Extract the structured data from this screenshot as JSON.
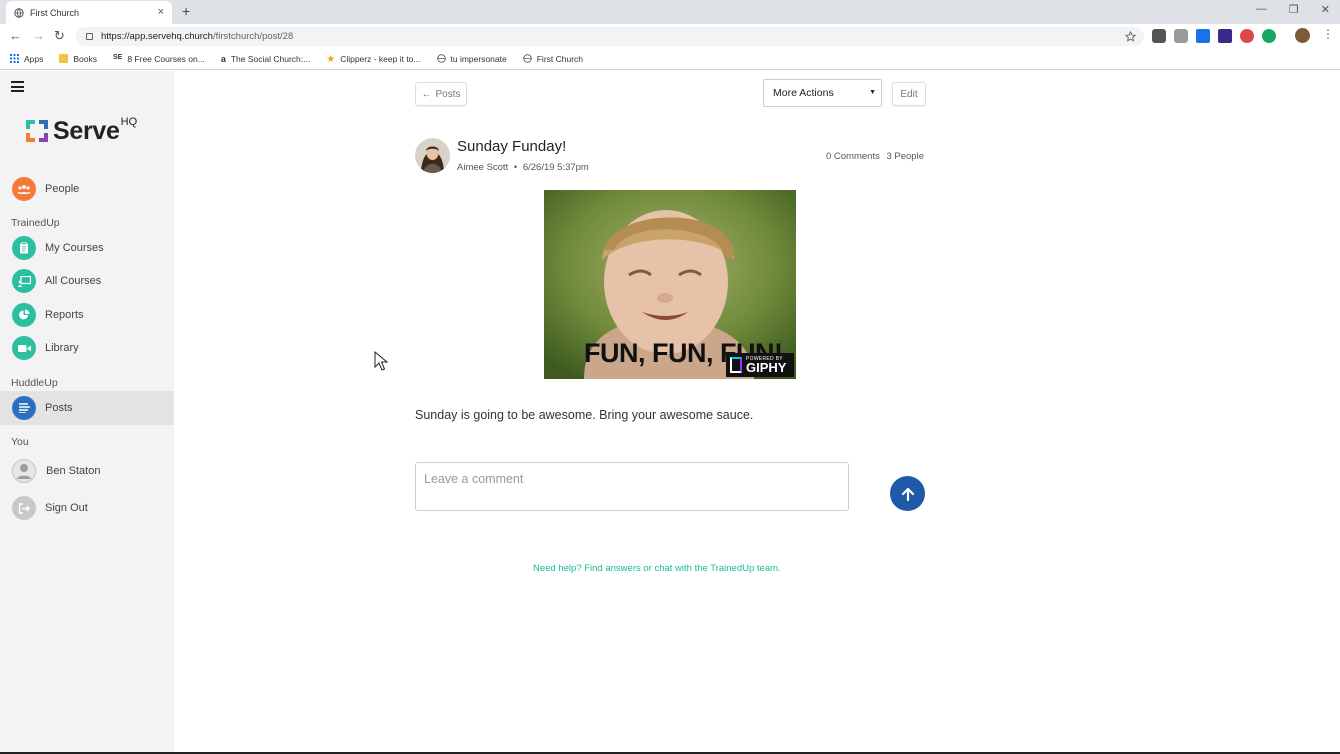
{
  "browser": {
    "tab_title": "First Church",
    "tab_close": "×",
    "new_tab": "+",
    "url_host": "https://app.servehq.church",
    "url_path": "/firstchurch/post/28",
    "bookmarks": [
      "Apps",
      "Books",
      "8 Free Courses on...",
      "The Social Church:...",
      "Clipperz - keep it to...",
      "tu impersonate",
      "First Church"
    ]
  },
  "sidebar": {
    "logo_text": "Serve",
    "logo_sup": "HQ",
    "people": "People",
    "trainedup_label": "TrainedUp",
    "my_courses": "My Courses",
    "all_courses": "All Courses",
    "reports": "Reports",
    "library": "Library",
    "huddleup_label": "HuddleUp",
    "posts": "Posts",
    "you_label": "You",
    "user_name": "Ben Staton",
    "sign_out": "Sign Out"
  },
  "toolbar": {
    "back_label": "Posts",
    "more_actions": "More Actions",
    "edit": "Edit"
  },
  "post": {
    "title": "Sunday Funday!",
    "author": "Aimee Scott",
    "separator": "•",
    "date": "6/26/19 5:37pm",
    "comments": "0 Comments",
    "people": "3 People",
    "gif_caption": "FUN, FUN, FUN!",
    "gif_badge_top": "POWERED BY",
    "gif_badge": "GIPHY",
    "body": "Sunday is going to be awesome. Bring your awesome sauce."
  },
  "comment": {
    "placeholder": "Leave a comment"
  },
  "footer": {
    "help": "Need help? Find answers or chat with the TrainedUp team."
  },
  "colors": {
    "people": "#f47a3a",
    "trainedup": "#2bbfa0",
    "posts": "#2e6fbd",
    "send": "#1e5aa8",
    "help_link": "#1bb99a"
  }
}
